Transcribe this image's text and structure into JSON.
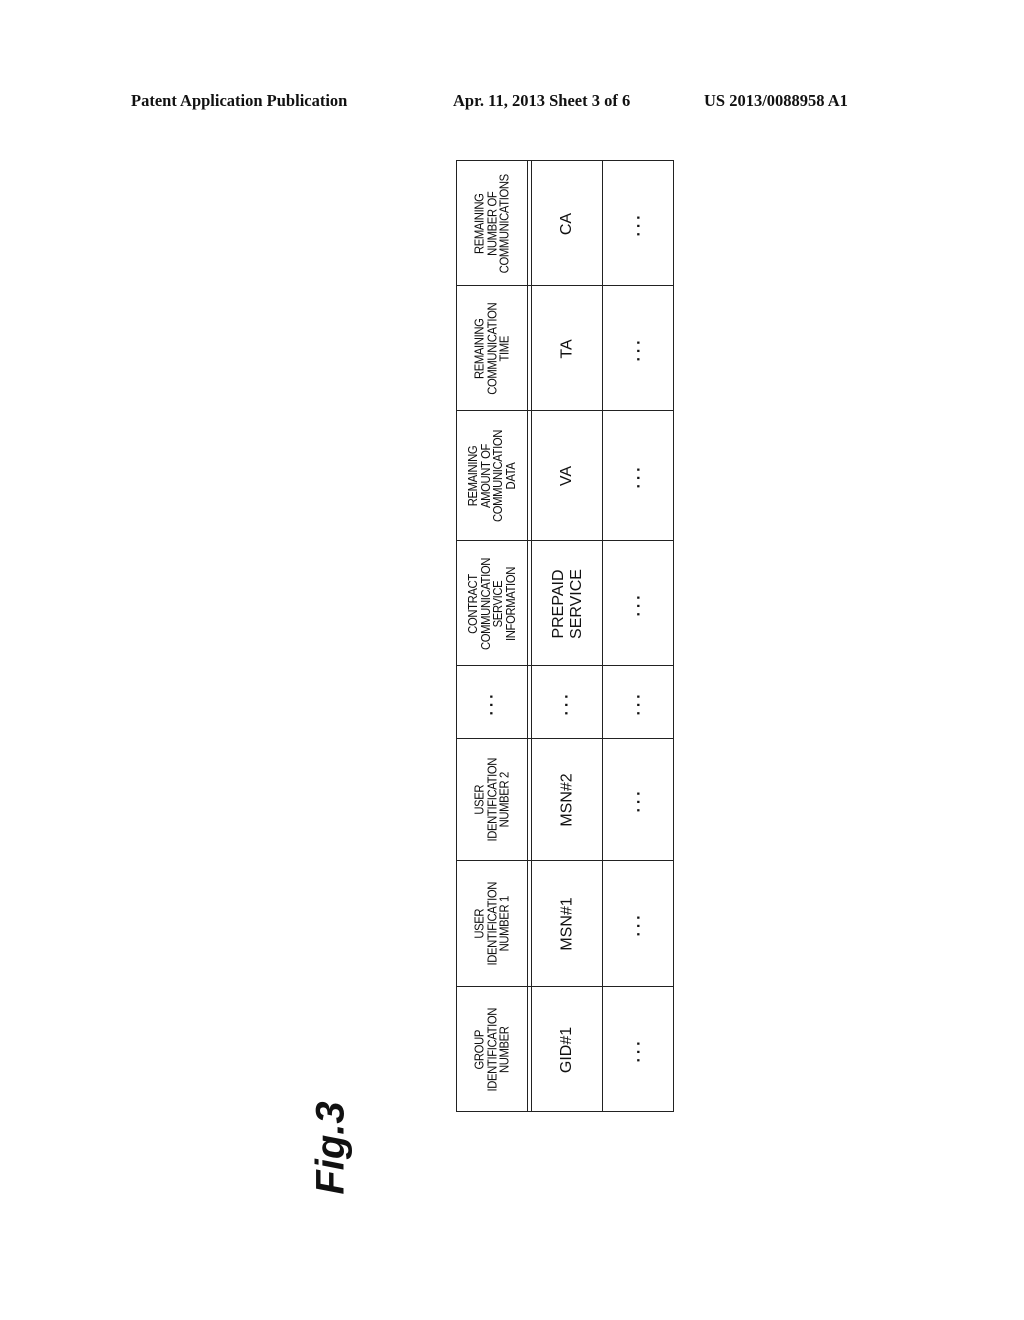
{
  "page_header": {
    "left": "Patent Application Publication",
    "middle": "Apr. 11, 2013  Sheet 3 of 6",
    "right": "US 2013/0088958 A1"
  },
  "figure_label": "Fig.3",
  "table": {
    "columns": [
      {
        "header": "GROUP\nIDENTIFICATION\nNUMBER",
        "row1": "GID#1",
        "row2": "…"
      },
      {
        "header": "USER\nIDENTIFICATION\nNUMBER 1",
        "row1": "MSN#1",
        "row2": "…"
      },
      {
        "header": "USER\nIDENTIFICATION\nNUMBER 2",
        "row1": "MSN#2",
        "row2": "…"
      },
      {
        "header": "…",
        "row1": "…",
        "row2": "…"
      },
      {
        "header": "CONTRACT\nCOMMUNICATION\nSERVICE\nINFORMATION",
        "row1": "PREPAID\nSERVICE",
        "row2": "…"
      },
      {
        "header": "REMAINING\nAMOUNT OF\nCOMMUNICATION\nDATA",
        "row1": "VA",
        "row2": "…"
      },
      {
        "header": "REMAINING\nCOMMUNICATION\nTIME",
        "row1": "TA",
        "row2": "…"
      },
      {
        "header": "REMAINING\nNUMBER OF\nCOMMUNICATIONS",
        "row1": "CA",
        "row2": "…"
      }
    ]
  }
}
